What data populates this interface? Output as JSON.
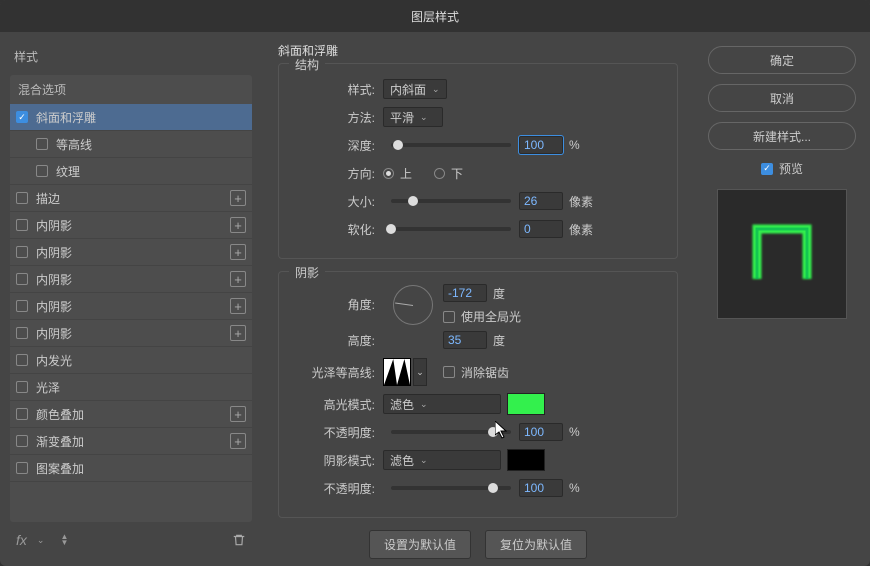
{
  "dialog": {
    "title": "图层样式"
  },
  "left": {
    "stylesHeader": "样式",
    "blendingOptions": "混合选项",
    "items": [
      {
        "label": "斜面和浮雕",
        "checked": true,
        "selected": true,
        "hasPlus": false,
        "sub": false
      },
      {
        "label": "等高线",
        "checked": false,
        "selected": false,
        "hasPlus": false,
        "sub": true
      },
      {
        "label": "纹理",
        "checked": false,
        "selected": false,
        "hasPlus": false,
        "sub": true
      },
      {
        "label": "描边",
        "checked": false,
        "selected": false,
        "hasPlus": true,
        "sub": false
      },
      {
        "label": "内阴影",
        "checked": false,
        "selected": false,
        "hasPlus": true,
        "sub": false
      },
      {
        "label": "内阴影",
        "checked": false,
        "selected": false,
        "hasPlus": true,
        "sub": false
      },
      {
        "label": "内阴影",
        "checked": false,
        "selected": false,
        "hasPlus": true,
        "sub": false
      },
      {
        "label": "内阴影",
        "checked": false,
        "selected": false,
        "hasPlus": true,
        "sub": false
      },
      {
        "label": "内阴影",
        "checked": false,
        "selected": false,
        "hasPlus": true,
        "sub": false
      },
      {
        "label": "内发光",
        "checked": false,
        "selected": false,
        "hasPlus": false,
        "sub": false
      },
      {
        "label": "光泽",
        "checked": false,
        "selected": false,
        "hasPlus": false,
        "sub": false
      },
      {
        "label": "颜色叠加",
        "checked": false,
        "selected": false,
        "hasPlus": true,
        "sub": false
      },
      {
        "label": "渐变叠加",
        "checked": false,
        "selected": false,
        "hasPlus": true,
        "sub": false
      },
      {
        "label": "图案叠加",
        "checked": false,
        "selected": false,
        "hasPlus": false,
        "sub": false
      }
    ],
    "fx": "fx"
  },
  "center": {
    "sectionTitle": "斜面和浮雕",
    "structure": {
      "legend": "结构",
      "styleLabel": "样式:",
      "styleValue": "内斜面",
      "techniqueLabel": "方法:",
      "techniqueValue": "平滑",
      "depthLabel": "深度:",
      "depthValue": "100",
      "depthUnit": "%",
      "depthPct": 6,
      "directionLabel": "方向:",
      "up": "上",
      "down": "下",
      "upSelected": true,
      "sizeLabel": "大小:",
      "sizeValue": "26",
      "sizeUnit": "像素",
      "sizePct": 18,
      "softenLabel": "软化:",
      "softenValue": "0",
      "softenUnit": "像素",
      "softenPct": 0
    },
    "shading": {
      "legend": "阴影",
      "angleLabel": "角度:",
      "angleValue": "-172",
      "angleUnit": "度",
      "globalLightLabel": "使用全局光",
      "globalLight": false,
      "altitudeLabel": "高度:",
      "altitudeValue": "35",
      "altitudeUnit": "度",
      "glossLabel": "光泽等高线:",
      "antiAliasLabel": "消除锯齿",
      "antiAlias": false,
      "hlModeLabel": "高光模式:",
      "hlModeValue": "滤色",
      "hlColor": "#33f04d",
      "hlOpacityLabel": "不透明度:",
      "hlOpacityValue": "100",
      "hlOpacityUnit": "%",
      "hlOpacityPct": 85,
      "shModeLabel": "阴影模式:",
      "shModeValue": "滤色",
      "shColor": "#000000",
      "shOpacityLabel": "不透明度:",
      "shOpacityValue": "100",
      "shOpacityUnit": "%",
      "shOpacityPct": 85
    },
    "footer": {
      "setDefault": "设置为默认值",
      "resetDefault": "复位为默认值"
    }
  },
  "right": {
    "ok": "确定",
    "cancel": "取消",
    "newStyle": "新建样式...",
    "previewLabel": "预览",
    "previewChecked": true
  }
}
